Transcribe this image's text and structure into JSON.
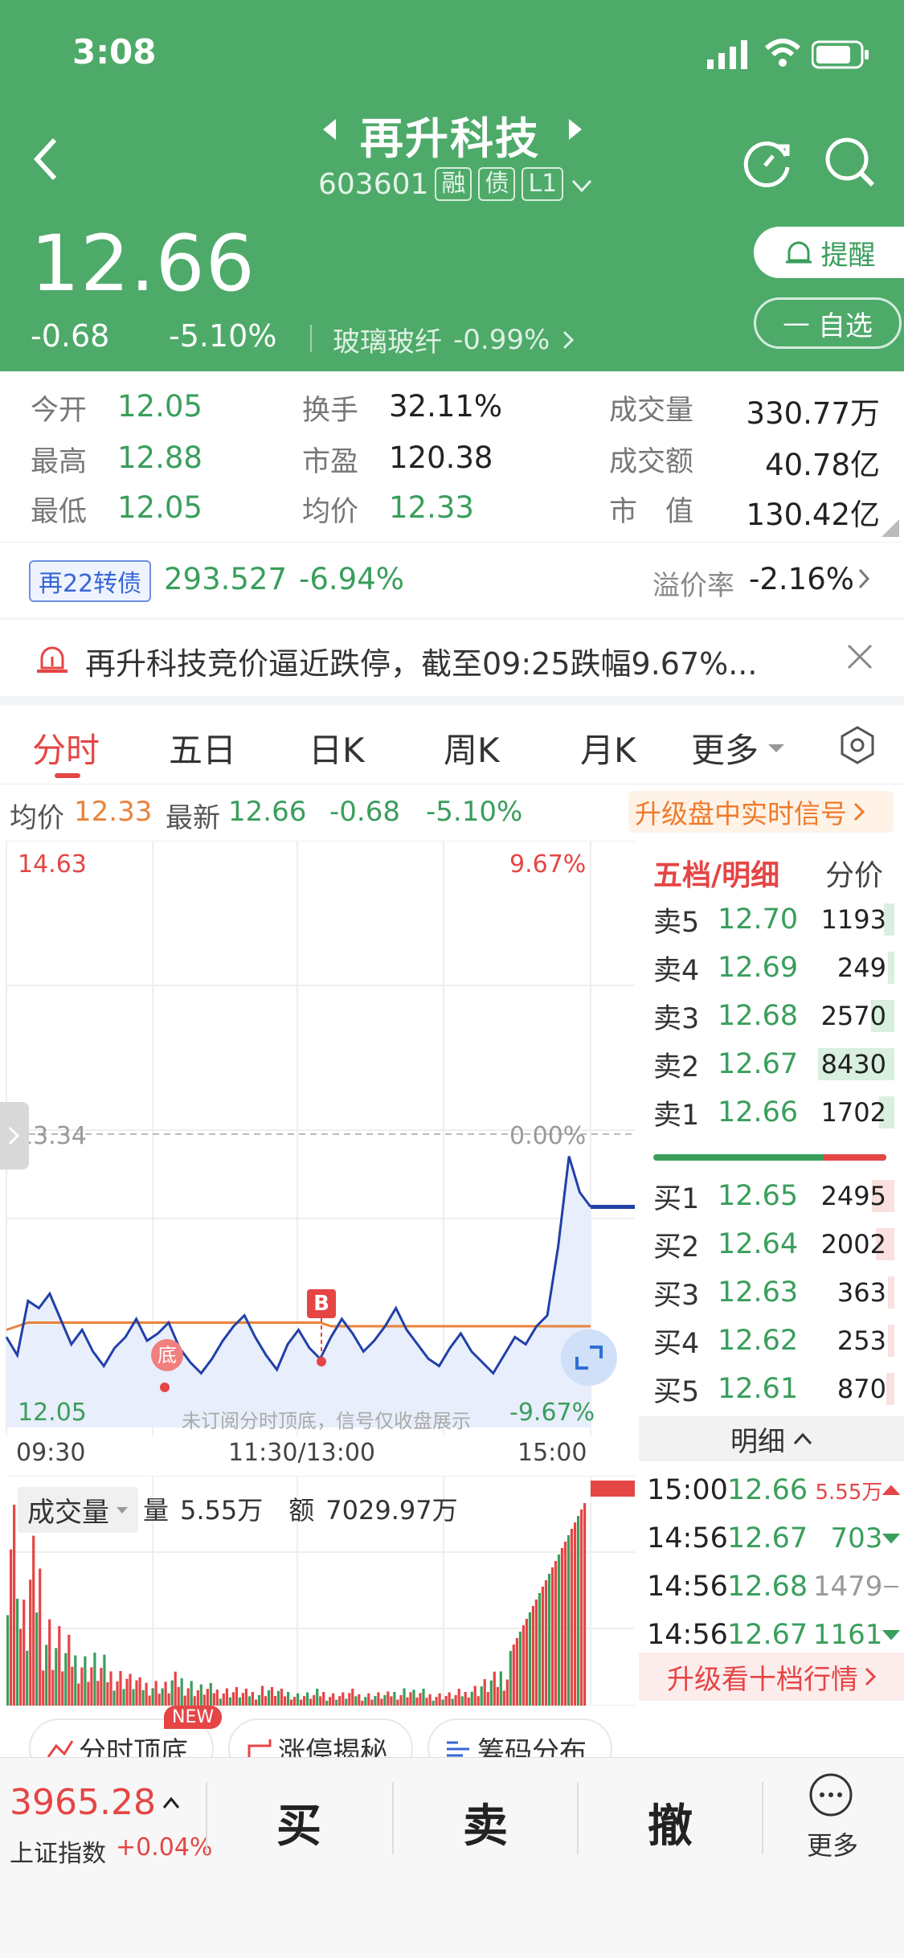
{
  "status_bar": {
    "time": "3:08"
  },
  "header": {
    "title": "再升科技",
    "code": "603601",
    "tags": [
      "融",
      "债",
      "L1"
    ],
    "price": "12.66",
    "change": "-0.68",
    "change_pct": "-5.10%",
    "sector": "玻璃玻纤",
    "sector_pct": "-0.99%",
    "remind_label": "提醒",
    "watch_label": "自选"
  },
  "quote": {
    "rows": [
      [
        {
          "label": "今开",
          "value": "12.05",
          "tone": "green"
        },
        {
          "label": "换手",
          "value": "32.11%",
          "tone": "dark"
        },
        {
          "label": "成交量",
          "value": "330.77万",
          "tone": "dark"
        }
      ],
      [
        {
          "label": "最高",
          "value": "12.88",
          "tone": "green"
        },
        {
          "label": "市盈",
          "value": "120.38",
          "tone": "dark"
        },
        {
          "label": "成交额",
          "value": "40.78亿",
          "tone": "dark"
        }
      ],
      [
        {
          "label": "最低",
          "value": "12.05",
          "tone": "green"
        },
        {
          "label": "均价",
          "value": "12.33",
          "tone": "green"
        },
        {
          "label": "市　值",
          "value": "130.42亿",
          "tone": "dark"
        }
      ]
    ]
  },
  "bond": {
    "tag": "再22转债",
    "price": "293.527",
    "pct": "-6.94%",
    "premium_label": "溢价率",
    "premium_value": "-2.16%"
  },
  "notice": {
    "text": "再升科技竞价逼近跌停，截至09:25跌幅9.67%..."
  },
  "tabs": {
    "items": [
      "分时",
      "五日",
      "日K",
      "周K",
      "月K",
      "更多"
    ],
    "active": "分时"
  },
  "info_line": {
    "avg_label": "均价",
    "avg_value": "12.33",
    "latest_label": "最新",
    "latest_value": "12.66",
    "change": "-0.68",
    "pct": "-5.10%",
    "upgrade": "升级盘中实时信号"
  },
  "chart_data": {
    "type": "line",
    "x_start": "09:30",
    "x_mid": "11:30/13:00",
    "x_end": "15:00",
    "y_top": "14.63",
    "y_mid": "13.34",
    "y_bottom": "12.05",
    "pct_top": "9.67%",
    "pct_mid": "0.00%",
    "pct_bottom": "-9.67%",
    "ylim": [
      12.05,
      14.63
    ],
    "markers": [
      "底",
      "B"
    ],
    "watermark": "未订阅分时顶底，信号仅收盘展示",
    "series": [
      {
        "values": [
          12.3,
          12.25,
          12.4,
          12.38,
          12.42,
          12.35,
          12.28,
          12.32,
          12.26,
          12.22,
          12.27,
          12.3,
          12.35,
          12.29,
          12.31,
          12.34,
          12.27,
          12.23,
          12.2,
          12.24,
          12.29,
          12.33,
          12.36,
          12.3,
          12.25,
          12.21,
          12.28,
          12.32,
          12.27,
          12.24,
          12.3,
          12.35,
          12.31,
          12.26,
          12.29,
          12.33,
          12.38,
          12.32,
          12.28,
          12.24,
          12.22,
          12.27,
          12.31,
          12.26,
          12.23,
          12.2,
          12.25,
          12.3,
          12.28,
          12.33,
          12.36,
          12.55,
          12.8,
          12.7,
          12.66
        ]
      },
      {
        "values": [
          12.32,
          12.33,
          12.34,
          12.34,
          12.34,
          12.34,
          12.34,
          12.34,
          12.34,
          12.34,
          12.34,
          12.34,
          12.34,
          12.34,
          12.34,
          12.34,
          12.34,
          12.34,
          12.34,
          12.34,
          12.34,
          12.34,
          12.34,
          12.34,
          12.34,
          12.34,
          12.34,
          12.34,
          12.34,
          12.34,
          12.33,
          12.33,
          12.33,
          12.33,
          12.33,
          12.33,
          12.33,
          12.33,
          12.33,
          12.33,
          12.33,
          12.33,
          12.33,
          12.33,
          12.33,
          12.33,
          12.33,
          12.33,
          12.33,
          12.33,
          12.33,
          12.33,
          12.33,
          12.33,
          12.33
        ]
      }
    ],
    "volume": {
      "label": "成交量",
      "vol_label": "量",
      "vol_value": "5.55万",
      "amt_label": "额",
      "amt_value": "7029.97万",
      "bars": [
        0.9,
        0.4,
        0.6,
        0.35,
        0.3,
        0.25,
        0.22,
        0.2,
        0.18,
        0.15,
        0.14,
        0.12,
        0.1,
        0.1,
        0.09,
        0.12,
        0.1,
        0.08,
        0.08,
        0.07,
        0.07,
        0.06,
        0.06,
        0.08,
        0.07,
        0.06,
        0.05,
        0.05,
        0.06,
        0.05,
        0.05,
        0.06,
        0.05,
        0.05,
        0.05,
        0.06,
        0.07,
        0.06,
        0.05,
        0.05,
        0.05,
        0.06,
        0.08,
        0.1,
        0.12,
        0.15,
        0.2,
        0.3,
        0.45,
        0.6,
        0.75,
        0.9,
        1.0
      ]
    }
  },
  "order_book": {
    "title": "五档/明细",
    "alt": "分价",
    "asks": [
      {
        "label": "卖5",
        "price": "12.70",
        "vol": "1193"
      },
      {
        "label": "卖4",
        "price": "12.69",
        "vol": "249"
      },
      {
        "label": "卖3",
        "price": "12.68",
        "vol": "2570"
      },
      {
        "label": "卖2",
        "price": "12.67",
        "vol": "8430"
      },
      {
        "label": "卖1",
        "price": "12.66",
        "vol": "1702"
      }
    ],
    "bids": [
      {
        "label": "买1",
        "price": "12.65",
        "vol": "2495"
      },
      {
        "label": "买2",
        "price": "12.64",
        "vol": "2002"
      },
      {
        "label": "买3",
        "price": "12.63",
        "vol": "363"
      },
      {
        "label": "买4",
        "price": "12.62",
        "vol": "253"
      },
      {
        "label": "买5",
        "price": "12.61",
        "vol": "870"
      }
    ],
    "detail_label": "明细",
    "ticks": [
      {
        "time": "15:00",
        "price": "12.66",
        "vol": "5.55万",
        "dir": "up"
      },
      {
        "time": "14:56",
        "price": "12.67",
        "vol": "703",
        "dir": "down"
      },
      {
        "time": "14:56",
        "price": "12.68",
        "vol": "1479",
        "dir": "flat"
      },
      {
        "time": "14:56",
        "price": "12.67",
        "vol": "1161",
        "dir": "down"
      }
    ],
    "upgrade": "升级看十档行情"
  },
  "shortcuts": {
    "items": [
      "分时顶底",
      "涨停揭秘",
      "筹码分布"
    ],
    "new_badge": "NEW"
  },
  "bottom": {
    "index_value": "3965.28",
    "index_name": "上证指数",
    "index_pct": "+0.04%",
    "buy": "买",
    "sell": "卖",
    "cancel": "撤",
    "more": "更多"
  },
  "colors": {
    "green": "#3a9e5c",
    "red": "#e54545",
    "header": "#4eaa69",
    "line": "#2140a8",
    "avg": "#e9833a"
  }
}
